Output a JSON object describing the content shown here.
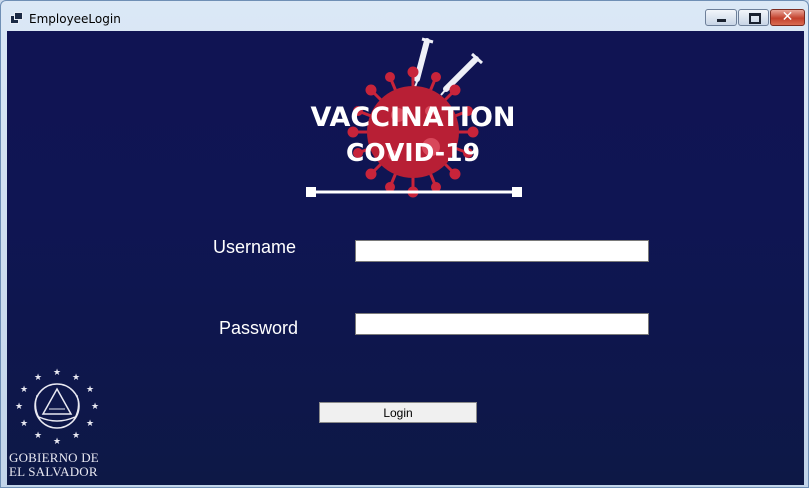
{
  "window": {
    "title": "EmployeeLogin",
    "controls": {
      "minimize": "minimize",
      "maximize": "maximize",
      "close": "✕"
    }
  },
  "logo": {
    "line1": "VACCINATION",
    "line2": "COVID-19"
  },
  "form": {
    "username_label": "Username",
    "username_value": "",
    "password_label": "Password",
    "password_value": "",
    "login_label": "Login"
  },
  "government": {
    "line1": "GOBIERNO DE",
    "line2": "EL SALVADOR"
  },
  "colors": {
    "background": "#101453",
    "virus": "#c8243a",
    "text": "#ffffff"
  },
  "icons": {
    "app": "app-window-icon",
    "logo": "virus-syringe-icon",
    "seal": "el-salvador-seal-icon"
  }
}
